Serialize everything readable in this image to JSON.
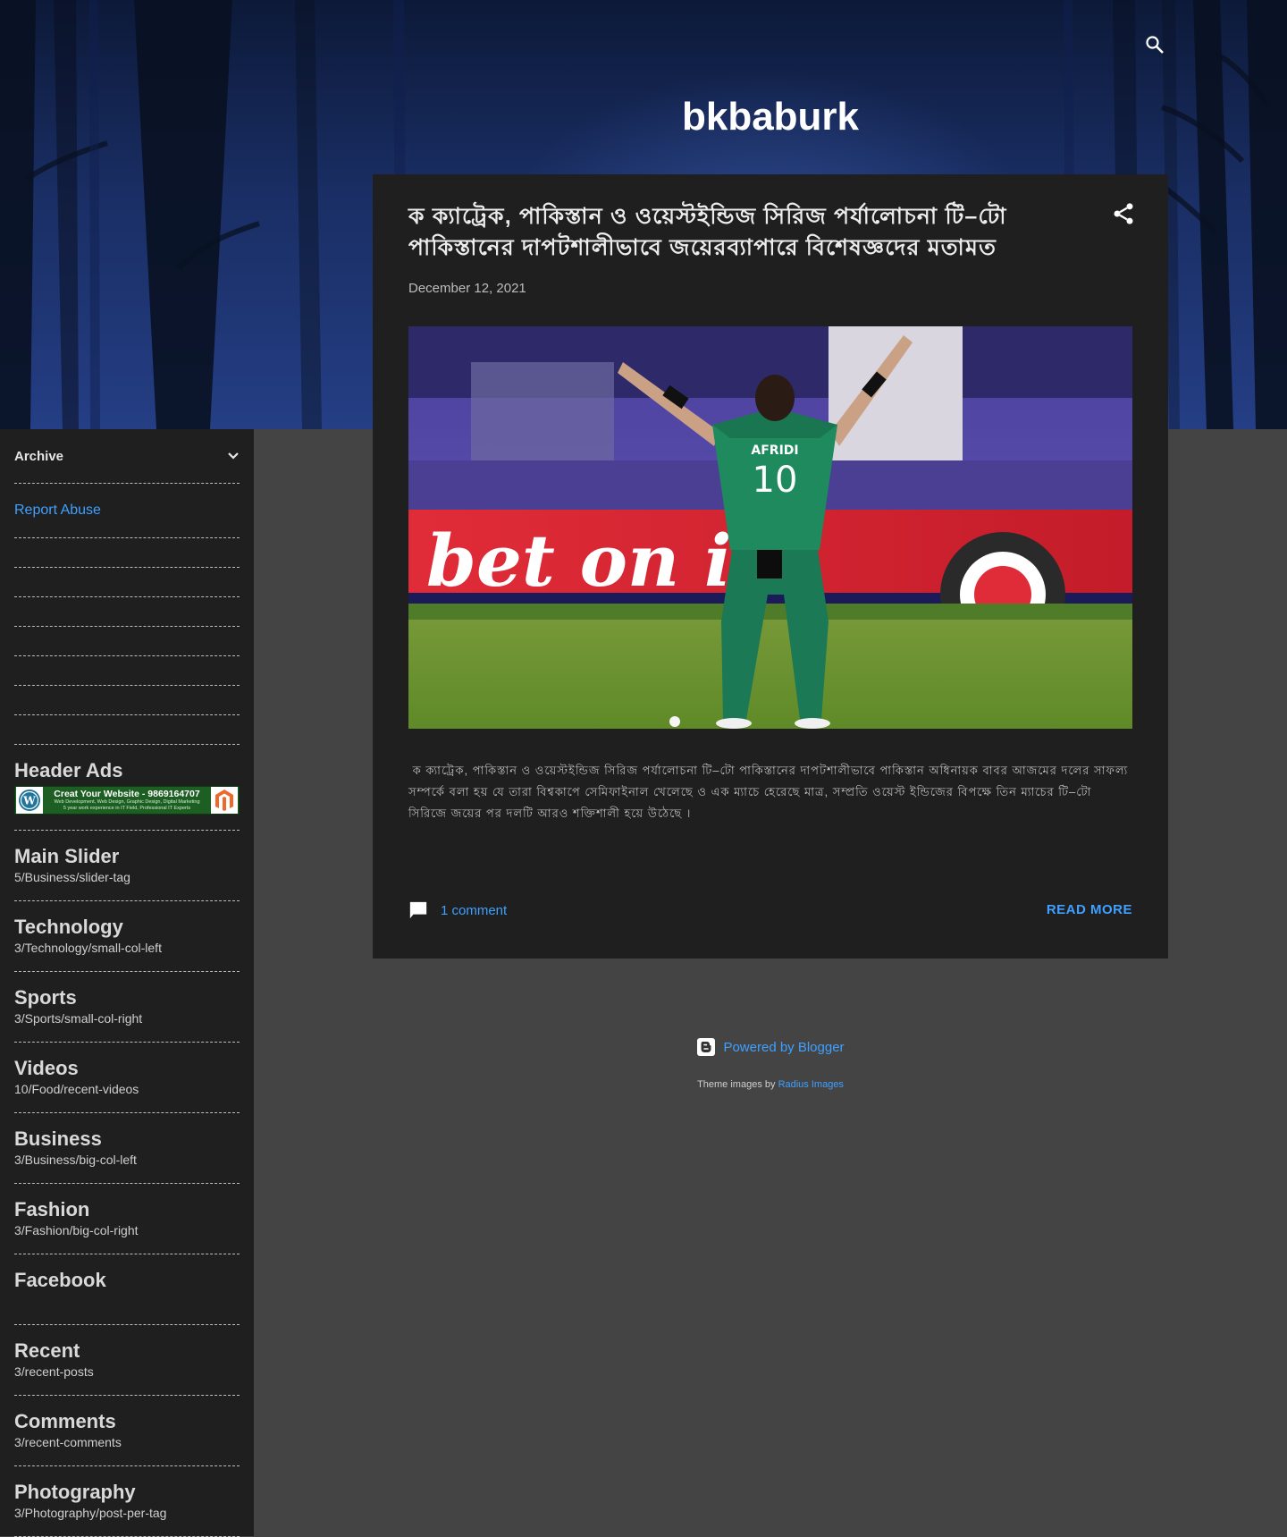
{
  "header": {
    "blog_title": "bkbaburk",
    "search_icon": "search-icon"
  },
  "post": {
    "title": "ক ক্যাট্রেক, পাকিস্তান ও ওয়েস্টইন্ডিজ সিরিজ পর্যালোচনা টি–টো পাকিস্তানের দাপটশালীভাবে জয়েরব্যাপারে বিশেষজ্ঞদের মতামত",
    "date": "December 12, 2021",
    "snippet": " ক ক্যাট্রেক, পাকিস্তান ও ওয়েস্টইন্ডিজ সিরিজ পর্যালোচনা টি–টো পাকিস্তানের দাপটশালীভাবে পাকিস্তান অধিনায়ক বাবর আজমের দলের সাফল্য সম্পর্কে বলা হয় যে তারা বিশ্বকাপে সেমিফাইনাল খেলেছে ও এক ম্যাচে হেরেছে মাত্র, সম্প্রতি ওয়েস্ট ইন্ডিজের বিপক্ষে তিন ম্যাচের টি–টো সিরিজে জয়ের পর দলটি আরও শক্তিশালী হয়ে উঠেছে ।",
    "comments": "1 comment",
    "read_more": "READ MORE"
  },
  "sidebar": {
    "archive_label": "Archive",
    "report_abuse": "Report Abuse",
    "header_ads": {
      "title": "Header Ads",
      "banner_text": "Creat Your Website - 9869164707",
      "banner_sub": "Web Development, Web Design, Graphic Design, Digital Marketing",
      "banner_sub2": "5 year work experience in IT Field, Professional IT Experts"
    },
    "widgets": [
      {
        "title": "Main Slider",
        "sub": "5/Business/slider-tag"
      },
      {
        "title": "Technology",
        "sub": "3/Technology/small-col-left"
      },
      {
        "title": "Sports",
        "sub": "3/Sports/small-col-right"
      },
      {
        "title": "Videos",
        "sub": "10/Food/recent-videos"
      },
      {
        "title": "Business",
        "sub": "3/Business/big-col-left"
      },
      {
        "title": "Fashion",
        "sub": "3/Fashion/big-col-right"
      },
      {
        "title": "Facebook",
        "sub": ""
      },
      {
        "title": "Recent",
        "sub": "3/recent-posts"
      },
      {
        "title": "Comments",
        "sub": "3/recent-comments"
      },
      {
        "title": "Photography",
        "sub": "3/Photography/post-per-tag"
      }
    ]
  },
  "footer": {
    "powered_by": "Powered by Blogger",
    "theme_prefix": "Theme images by",
    "theme_link": "Radius Images"
  },
  "image": {
    "jersey_name": "AFRIDI",
    "jersey_number": "10",
    "board_text": "bet on it"
  },
  "colors": {
    "link": "#3fa0ff",
    "card": "#1f1f1f",
    "page": "#444444"
  }
}
